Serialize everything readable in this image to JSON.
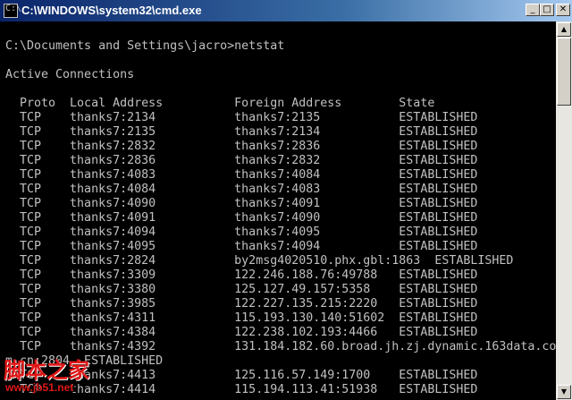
{
  "window": {
    "title": "C:\\WINDOWS\\system32\\cmd.exe",
    "icon": "cmd-icon",
    "buttons": {
      "minimize": "_",
      "maximize": "□",
      "close": "✕"
    }
  },
  "console": {
    "prompt": "C:\\Documents and Settings\\jacro>netstat",
    "heading": "Active Connections",
    "columns": "  Proto  Local Address          Foreign Address        State",
    "rows": [
      "  TCP    thanks7:2134           thanks7:2135           ESTABLISHED",
      "  TCP    thanks7:2135           thanks7:2134           ESTABLISHED",
      "  TCP    thanks7:2832           thanks7:2836           ESTABLISHED",
      "  TCP    thanks7:2836           thanks7:2832           ESTABLISHED",
      "  TCP    thanks7:4083           thanks7:4084           ESTABLISHED",
      "  TCP    thanks7:4084           thanks7:4083           ESTABLISHED",
      "  TCP    thanks7:4090           thanks7:4091           ESTABLISHED",
      "  TCP    thanks7:4091           thanks7:4090           ESTABLISHED",
      "  TCP    thanks7:4094           thanks7:4095           ESTABLISHED",
      "  TCP    thanks7:4095           thanks7:4094           ESTABLISHED",
      "  TCP    thanks7:2824           by2msg4020510.phx.gbl:1863  ESTABLISHED",
      "  TCP    thanks7:3309           122.246.188.76:49788   ESTABLISHED",
      "  TCP    thanks7:3380           125.127.49.157:5358    ESTABLISHED",
      "  TCP    thanks7:3985           122.227.135.215:2220   ESTABLISHED",
      "  TCP    thanks7:4311           115.193.130.140:51602  ESTABLISHED",
      "  TCP    thanks7:4384           122.238.102.193:4466   ESTABLISHED",
      "  TCP    thanks7:4392           131.184.182.60.broad.jh.zj.dynamic.163data.co",
      "m.cn:2804  ESTABLISHED",
      "  TCP    thanks7:4413           125.116.57.149:1700    ESTABLISHED",
      "  TCP    thanks7:4414           115.194.113.41:51938   ESTABLISHED"
    ]
  },
  "watermark": {
    "text": "脚本之家",
    "url": "www.jb51.net"
  },
  "colors": {
    "console_bg": "#000000",
    "console_fg": "#c0c0c0",
    "titlebar_start": "#0a246a",
    "titlebar_end": "#a6caf0",
    "watermark": "#e01818"
  }
}
